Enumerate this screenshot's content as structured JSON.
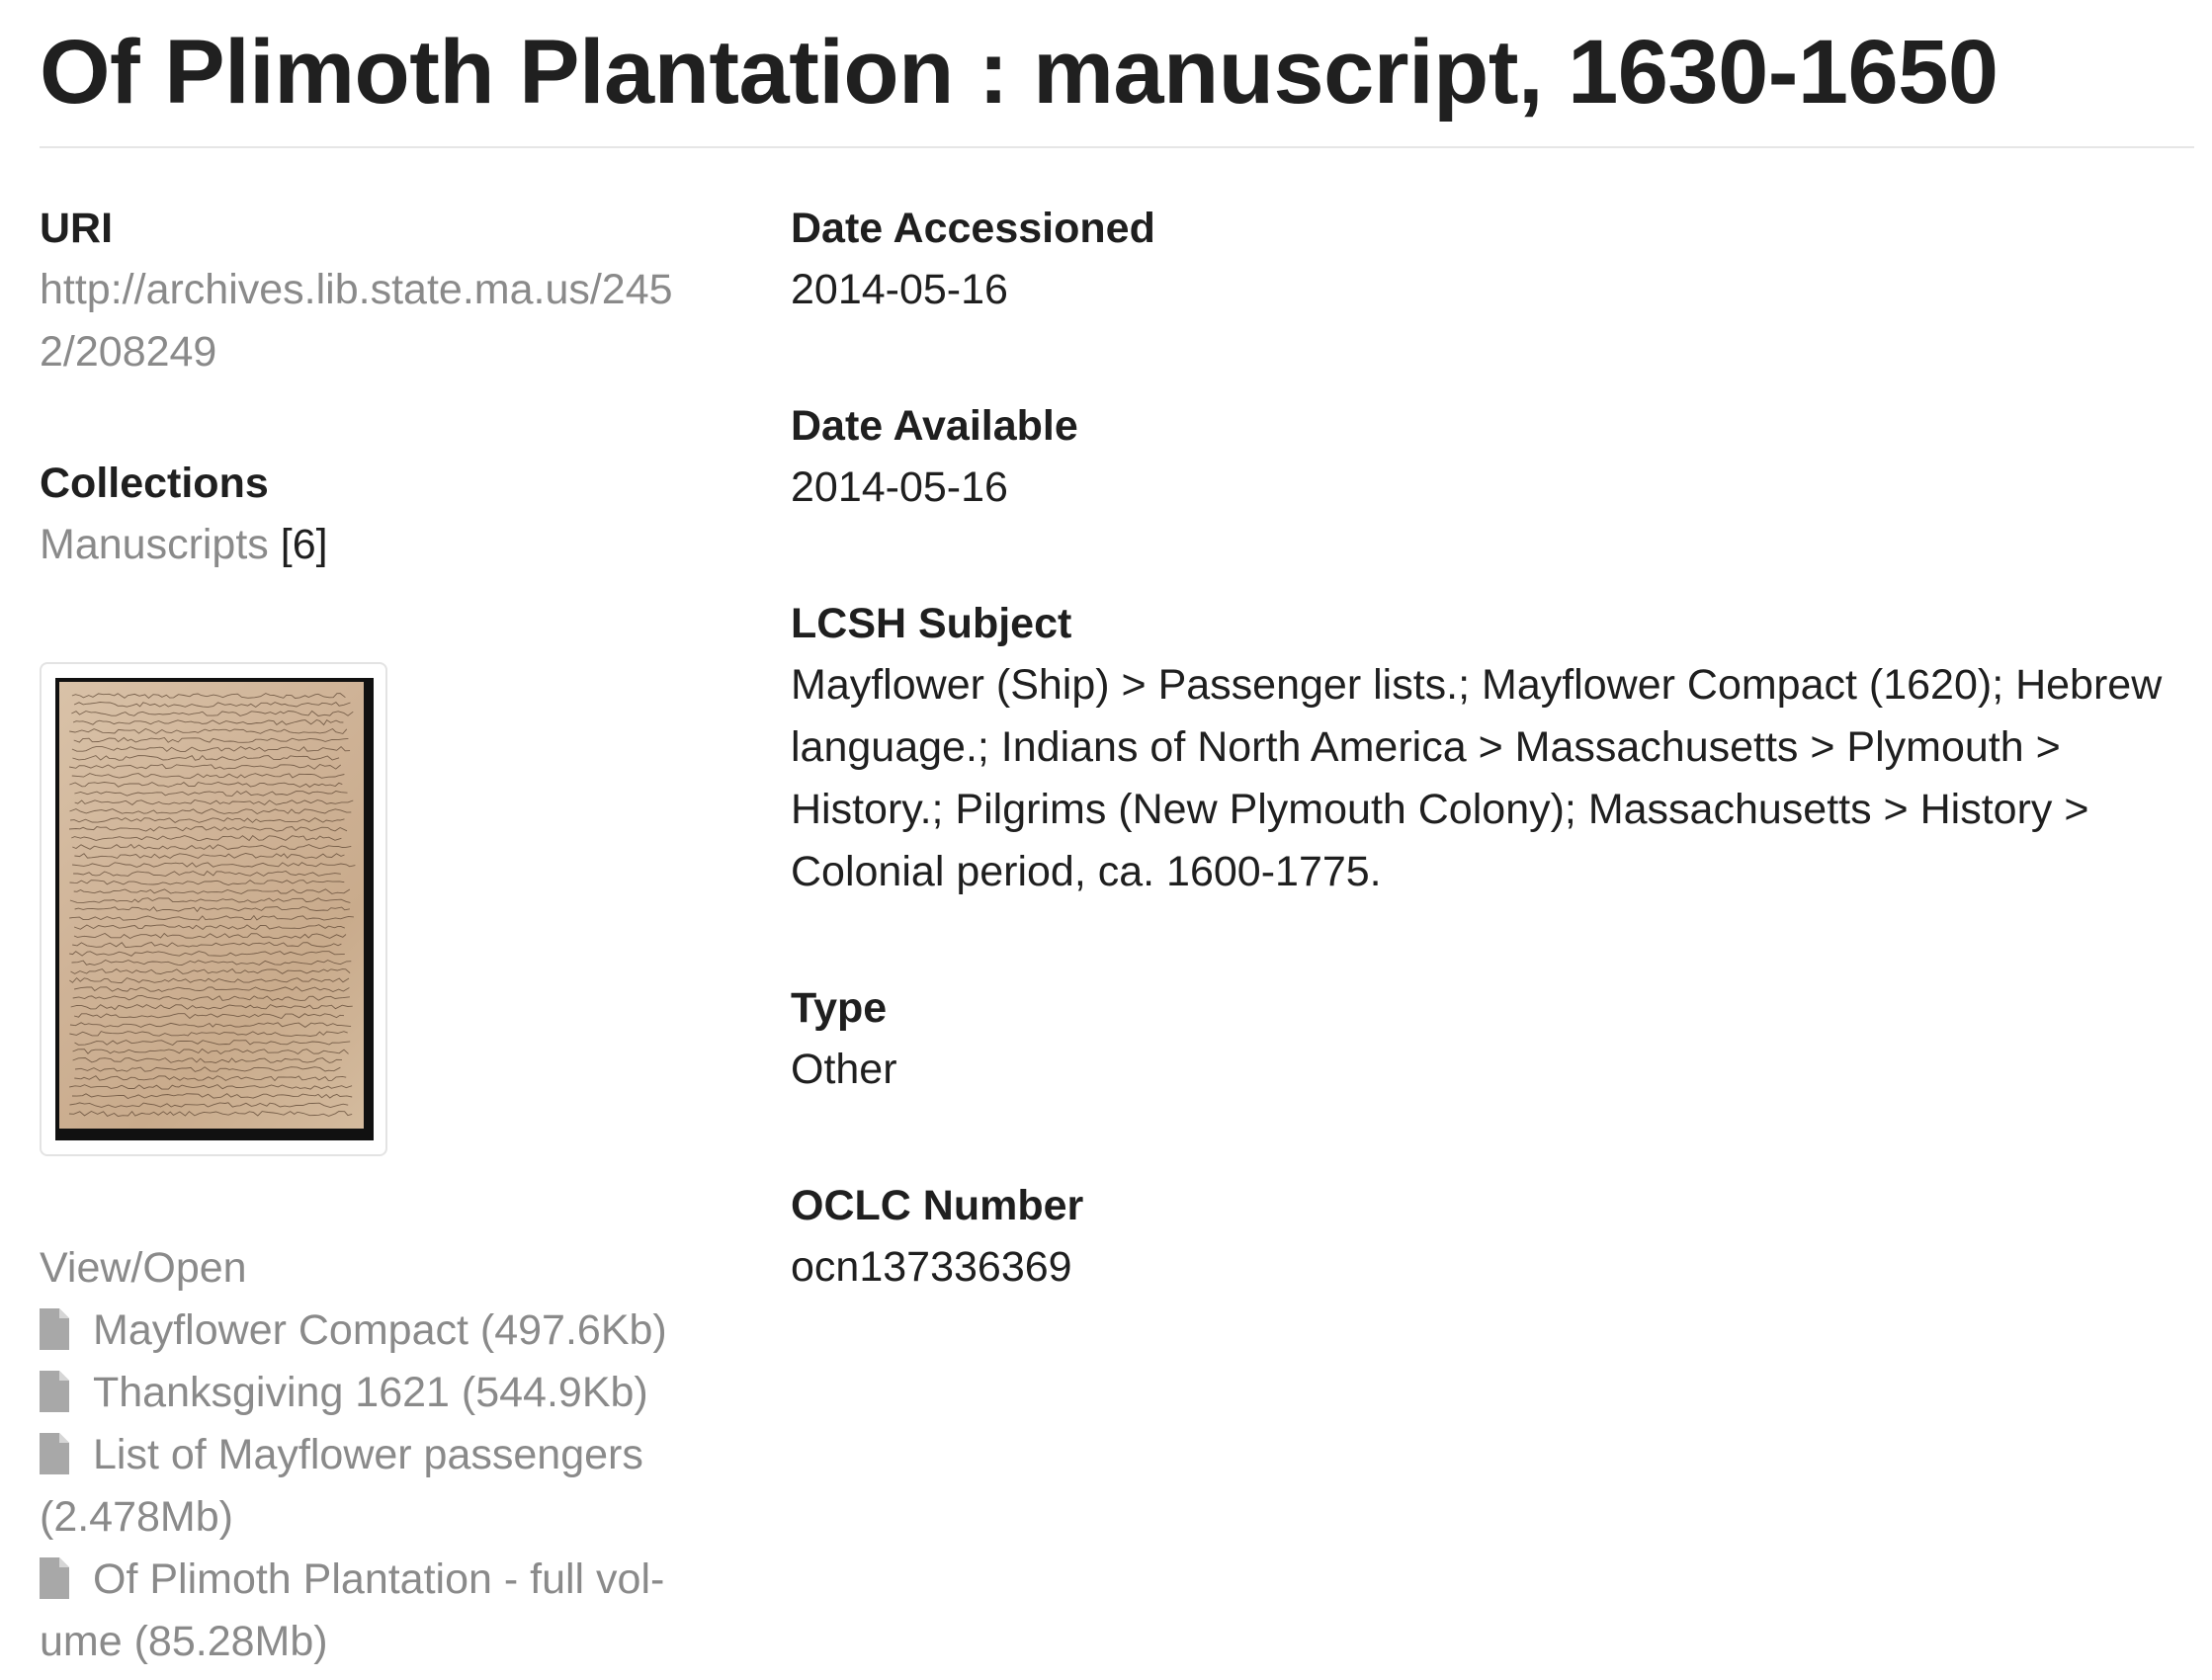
{
  "title": "Of Plimoth Plantation : manuscript, 1630-1650",
  "uri": {
    "label": "URI",
    "value": "http://archives.lib.state.ma.us/2452/208249"
  },
  "collections": {
    "label": "Collections",
    "link": "Manuscripts",
    "count": "[6]"
  },
  "thumbnail": {
    "icon": "manuscript-page-thumbnail"
  },
  "files": {
    "label": "View/Open",
    "items": [
      {
        "name": "Mayflower Compact (497.6Kb)"
      },
      {
        "name": "Thanksgiving 1621 (544.9Kb)"
      },
      {
        "name": "List of Mayflower passengers (2.478Mb)"
      },
      {
        "name": "Of Plimoth Plantation - full vol-ume (85.28Mb)"
      }
    ],
    "icon": "file-icon"
  },
  "fields": {
    "date_accessioned": {
      "label": "Date Accessioned",
      "value": "2014-05-16"
    },
    "date_available": {
      "label": "Date Available",
      "value": "2014-05-16"
    },
    "lcsh_subject": {
      "label": "LCSH Subject",
      "value": "Mayflower (Ship) > Passenger lists.; Mayflower Compact (1620); Hebrew language.; Indians of North America > Massachusetts > Plymouth > History.; Pilgrims (New Plymouth Colony); Massachusetts > History > Colonial period, ca. 1600-1775."
    },
    "type": {
      "label": "Type",
      "value": "Other"
    },
    "oclc_number": {
      "label": "OCLC Number",
      "value": "ocn137336369"
    }
  },
  "colors": {
    "text": "#1f1f1f",
    "muted_link": "#8a8a8a",
    "rule": "#e6e6e6"
  }
}
